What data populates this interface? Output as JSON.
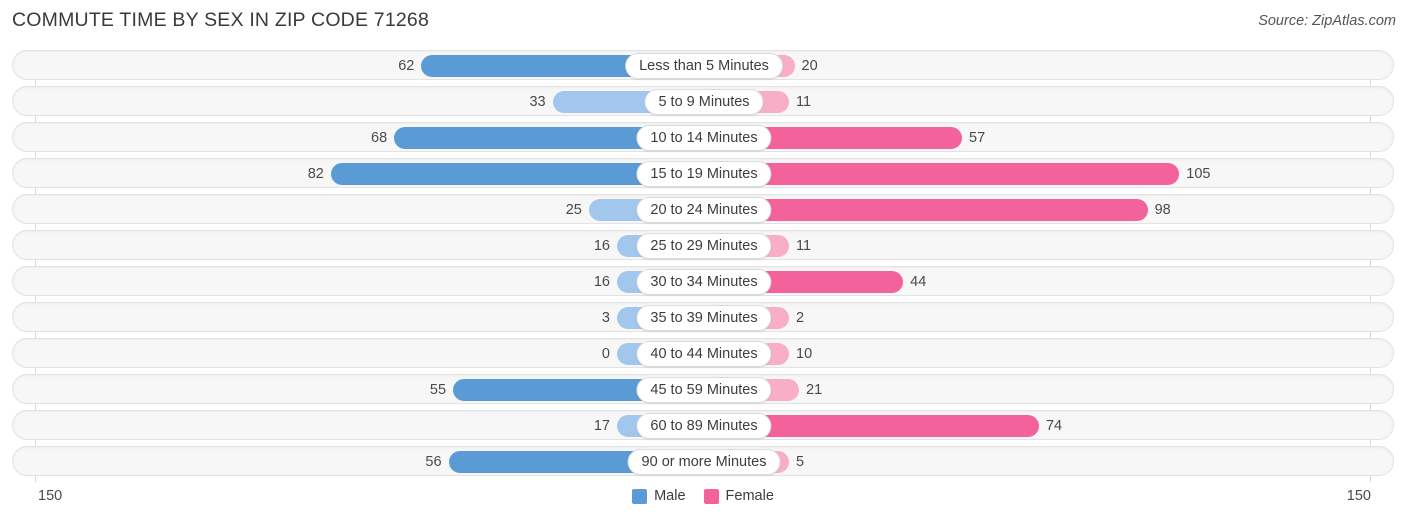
{
  "header": {
    "title": "COMMUTE TIME BY SEX IN ZIP CODE 71268",
    "source": "Source: ZipAtlas.com"
  },
  "axis": {
    "left_label": "150",
    "right_label": "150",
    "max": 150
  },
  "legend": {
    "items": [
      {
        "label": "Male",
        "color": "#5b9bd5"
      },
      {
        "label": "Female",
        "color": "#f4629b"
      }
    ]
  },
  "colors": {
    "male_strong": "#5b9bd5",
    "male_light": "#a3c6ec",
    "female_strong": "#f4629b",
    "female_light": "#f9aec7",
    "track_bg": "#f7f7f7",
    "track_border": "#e3e3e3",
    "pill_bg": "#ffffff",
    "text": "#4a4a4a"
  },
  "chart_data": {
    "type": "bar",
    "title": "COMMUTE TIME BY SEX IN ZIP CODE 71268",
    "subtitle": "Source: ZipAtlas.com",
    "orientation": "horizontal-diverging",
    "xlabel": "",
    "ylabel": "",
    "xlim": [
      -150,
      150
    ],
    "axis_tick_labels": [
      "150",
      "150"
    ],
    "grid": false,
    "legend_position": "bottom-center",
    "categories": [
      "Less than 5 Minutes",
      "5 to 9 Minutes",
      "10 to 14 Minutes",
      "15 to 19 Minutes",
      "20 to 24 Minutes",
      "25 to 29 Minutes",
      "30 to 34 Minutes",
      "35 to 39 Minutes",
      "40 to 44 Minutes",
      "45 to 59 Minutes",
      "60 to 89 Minutes",
      "90 or more Minutes"
    ],
    "series": [
      {
        "name": "Male",
        "side": "left",
        "values": [
          62,
          33,
          68,
          82,
          25,
          16,
          16,
          3,
          0,
          55,
          17,
          56
        ]
      },
      {
        "name": "Female",
        "side": "right",
        "values": [
          20,
          11,
          57,
          105,
          98,
          11,
          44,
          2,
          10,
          21,
          74,
          5
        ]
      }
    ]
  },
  "rows": [
    {
      "label": "Less than 5 Minutes",
      "male": "62",
      "female": "20"
    },
    {
      "label": "5 to 9 Minutes",
      "male": "33",
      "female": "11"
    },
    {
      "label": "10 to 14 Minutes",
      "male": "68",
      "female": "57"
    },
    {
      "label": "15 to 19 Minutes",
      "male": "82",
      "female": "105"
    },
    {
      "label": "20 to 24 Minutes",
      "male": "25",
      "female": "98"
    },
    {
      "label": "25 to 29 Minutes",
      "male": "16",
      "female": "11"
    },
    {
      "label": "30 to 34 Minutes",
      "male": "16",
      "female": "44"
    },
    {
      "label": "35 to 39 Minutes",
      "male": "3",
      "female": "2"
    },
    {
      "label": "40 to 44 Minutes",
      "male": "0",
      "female": "10"
    },
    {
      "label": "45 to 59 Minutes",
      "male": "55",
      "female": "21"
    },
    {
      "label": "60 to 89 Minutes",
      "male": "17",
      "female": "74"
    },
    {
      "label": "90 or more Minutes",
      "male": "56",
      "female": "5"
    }
  ]
}
